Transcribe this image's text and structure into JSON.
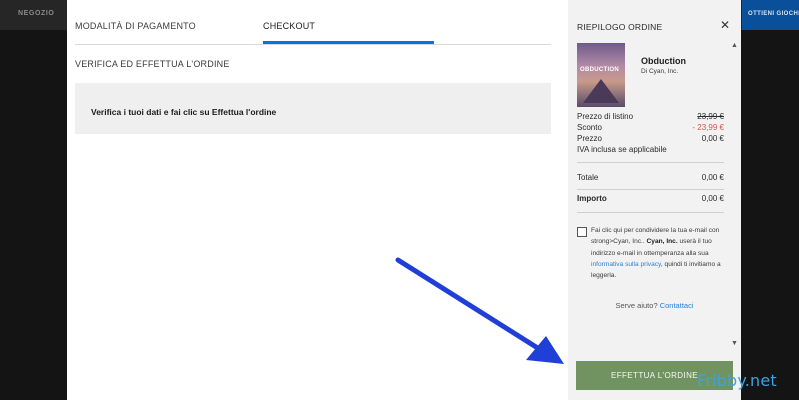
{
  "background": {
    "store_label": "NEGOZIO",
    "cta_label": "OTTIENI GIOCHI E"
  },
  "tabs": {
    "payment_methods": "MODALITÀ DI PAGAMENTO",
    "checkout": "CHECKOUT"
  },
  "main": {
    "section_title": "VERIFICA ED EFFETTUA L'ORDINE",
    "verify_message": "Verifica i tuoi dati e fai clic su Effettua l'ordine"
  },
  "summary": {
    "title": "RIEPILOGO ORDINE",
    "close_icon": "close-icon",
    "product": {
      "cover_text": "OBDUCTION",
      "name": "Obduction",
      "developer": "Di Cyan, Inc."
    },
    "prices": {
      "list_label": "Prezzo di listino",
      "list_value": "23,99 €",
      "discount_label": "Sconto",
      "discount_value": "- 23,99 €",
      "price_label": "Prezzo",
      "price_value": "0,00 €",
      "vat_note": "IVA inclusa se applicabile"
    },
    "totals": {
      "total_label": "Totale",
      "total_value": "0,00 €",
      "amount_label": "Importo",
      "amount_value": "0,00 €"
    },
    "consent": {
      "text_1": "Fai clic qui per condividere la tua e-mail con strong>Cyan, Inc.. ",
      "bold": "Cyan, Inc.",
      "text_2": " userà il tuo indirizzo e-mail in ottemperanza alla sua ",
      "link": "informativa sulla privacy",
      "text_3": ", quindi ti invitiamo a leggerla."
    },
    "help": {
      "question": "Serve aiuto?",
      "contact_link": "Contattaci"
    },
    "order_button": "EFFETTUA L'ORDINE"
  },
  "colors": {
    "accent_blue": "#0074e4",
    "order_button": "#719362",
    "discount_red": "#d9534f",
    "arrow_blue": "#1f3fd6"
  },
  "watermark": "Fribby.net"
}
